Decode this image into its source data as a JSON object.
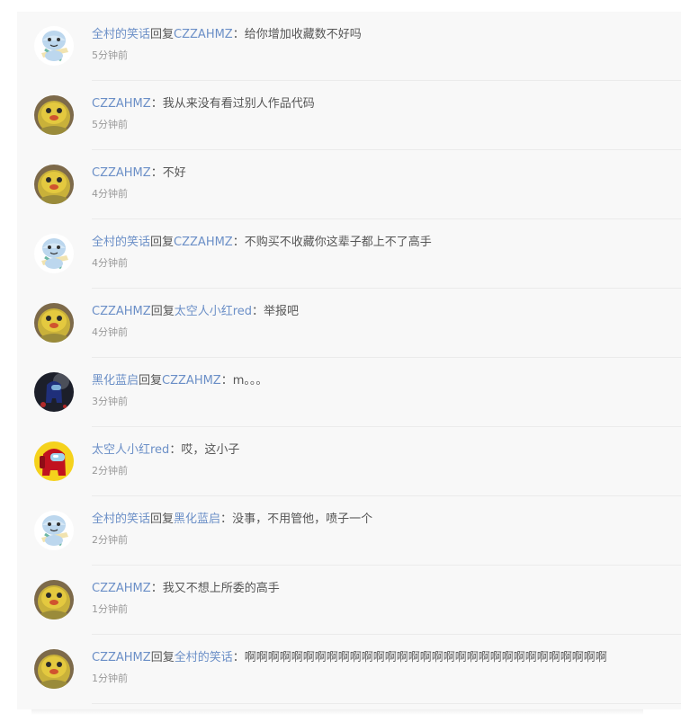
{
  "comments": [
    {
      "author": "全村的笑话",
      "reply_word": "回复",
      "target": "CZZAHMZ",
      "sep": "：",
      "content": "给你增加收藏数不好吗",
      "time": "5分钟前",
      "avatar": "shark-avatar"
    },
    {
      "author": "CZZAHMZ",
      "reply_word": "",
      "target": "",
      "sep": "：",
      "content": "我从来没有看过别人作品代码",
      "time": "5分钟前",
      "avatar": "duck-avatar"
    },
    {
      "author": "CZZAHMZ",
      "reply_word": "",
      "target": "",
      "sep": "：",
      "content": "不好",
      "time": "4分钟前",
      "avatar": "duck-avatar"
    },
    {
      "author": "全村的笑话",
      "reply_word": "回复",
      "target": "CZZAHMZ",
      "sep": "：",
      "content": "不购买不收藏你这辈子都上不了高手",
      "time": "4分钟前",
      "avatar": "shark-avatar"
    },
    {
      "author": "CZZAHMZ",
      "reply_word": "回复",
      "target": "太空人小红red",
      "sep": "：",
      "content": "举报吧",
      "time": "4分钟前",
      "avatar": "duck-avatar"
    },
    {
      "author": "黑化蓝启",
      "reply_word": "回复",
      "target": "CZZAHMZ",
      "sep": "：",
      "content": "m。。。",
      "time": "3分钟前",
      "avatar": "dark-crewmate-avatar"
    },
    {
      "author": "太空人小红red",
      "reply_word": "",
      "target": "",
      "sep": "：",
      "content": "哎，这小子",
      "time": "2分钟前",
      "avatar": "red-crewmate-avatar"
    },
    {
      "author": "全村的笑话",
      "reply_word": "回复",
      "target": "黑化蓝启",
      "sep": "：",
      "content": "没事，不用管他，喷子一个",
      "time": "2分钟前",
      "avatar": "shark-avatar"
    },
    {
      "author": "CZZAHMZ",
      "reply_word": "",
      "target": "",
      "sep": "：",
      "content": "我又不想上所委的高手",
      "time": "1分钟前",
      "avatar": "duck-avatar"
    },
    {
      "author": "CZZAHMZ",
      "reply_word": "回复",
      "target": "全村的笑话",
      "sep": "：",
      "content": "啊啊啊啊啊啊啊啊啊啊啊啊啊啊啊啊啊啊啊啊啊啊啊啊啊啊啊啊啊啊啊",
      "time": "1分钟前",
      "avatar": "duck-avatar"
    }
  ],
  "colors": {
    "username": "#6b8fc7",
    "text": "#555555",
    "time": "#999999",
    "panel_bg": "#f8f8f8"
  }
}
